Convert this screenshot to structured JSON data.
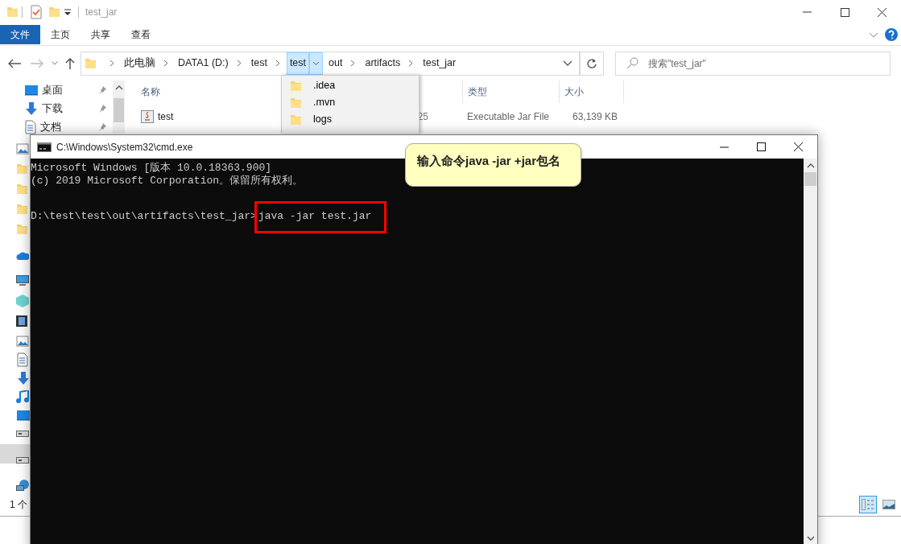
{
  "explorer": {
    "title": "test_jar",
    "ribbon_tabs": [
      {
        "label": "文件",
        "selected": true
      },
      {
        "label": "主页",
        "selected": false
      },
      {
        "label": "共享",
        "selected": false
      },
      {
        "label": "查看",
        "selected": false
      }
    ],
    "breadcrumbs": [
      {
        "label": "此电脑",
        "selected": false
      },
      {
        "label": "DATA1 (D:)",
        "selected": false
      },
      {
        "label": "test",
        "selected": false
      },
      {
        "label": "test",
        "selected": true
      },
      {
        "label": "out",
        "selected": false
      },
      {
        "label": "artifacts",
        "selected": false
      },
      {
        "label": "test_jar",
        "selected": false
      }
    ],
    "search": {
      "placeholder": "搜索\"test_jar\""
    },
    "sidebar": {
      "items": [
        {
          "label": "桌面",
          "kind": "desktop"
        },
        {
          "label": "下载",
          "kind": "download"
        },
        {
          "label": "文档",
          "kind": "document"
        }
      ]
    },
    "columns": [
      "名称",
      "类型",
      "大小"
    ],
    "files": [
      {
        "name": "test",
        "column_2": "25",
        "type": "Executable Jar File",
        "size": "63,139 KB"
      }
    ],
    "status_bar": "1 个",
    "view_buttons": [
      {
        "kind": "details",
        "selected": true
      },
      {
        "kind": "thumbnails",
        "selected": false
      }
    ]
  },
  "folder_dropdown": {
    "items": [
      ".idea",
      ".mvn",
      "logs"
    ]
  },
  "console": {
    "title": "C:\\Windows\\System32\\cmd.exe",
    "lines": [
      "Microsoft Windows [版本 10.0.18363.900]",
      "(c) 2019 Microsoft Corporation。保留所有权利。"
    ],
    "prompt": "D:\\test\\test\\out\\artifacts\\test_jar>",
    "command": "java -jar test.jar"
  },
  "callout": "输入命令java -jar +jar包名"
}
